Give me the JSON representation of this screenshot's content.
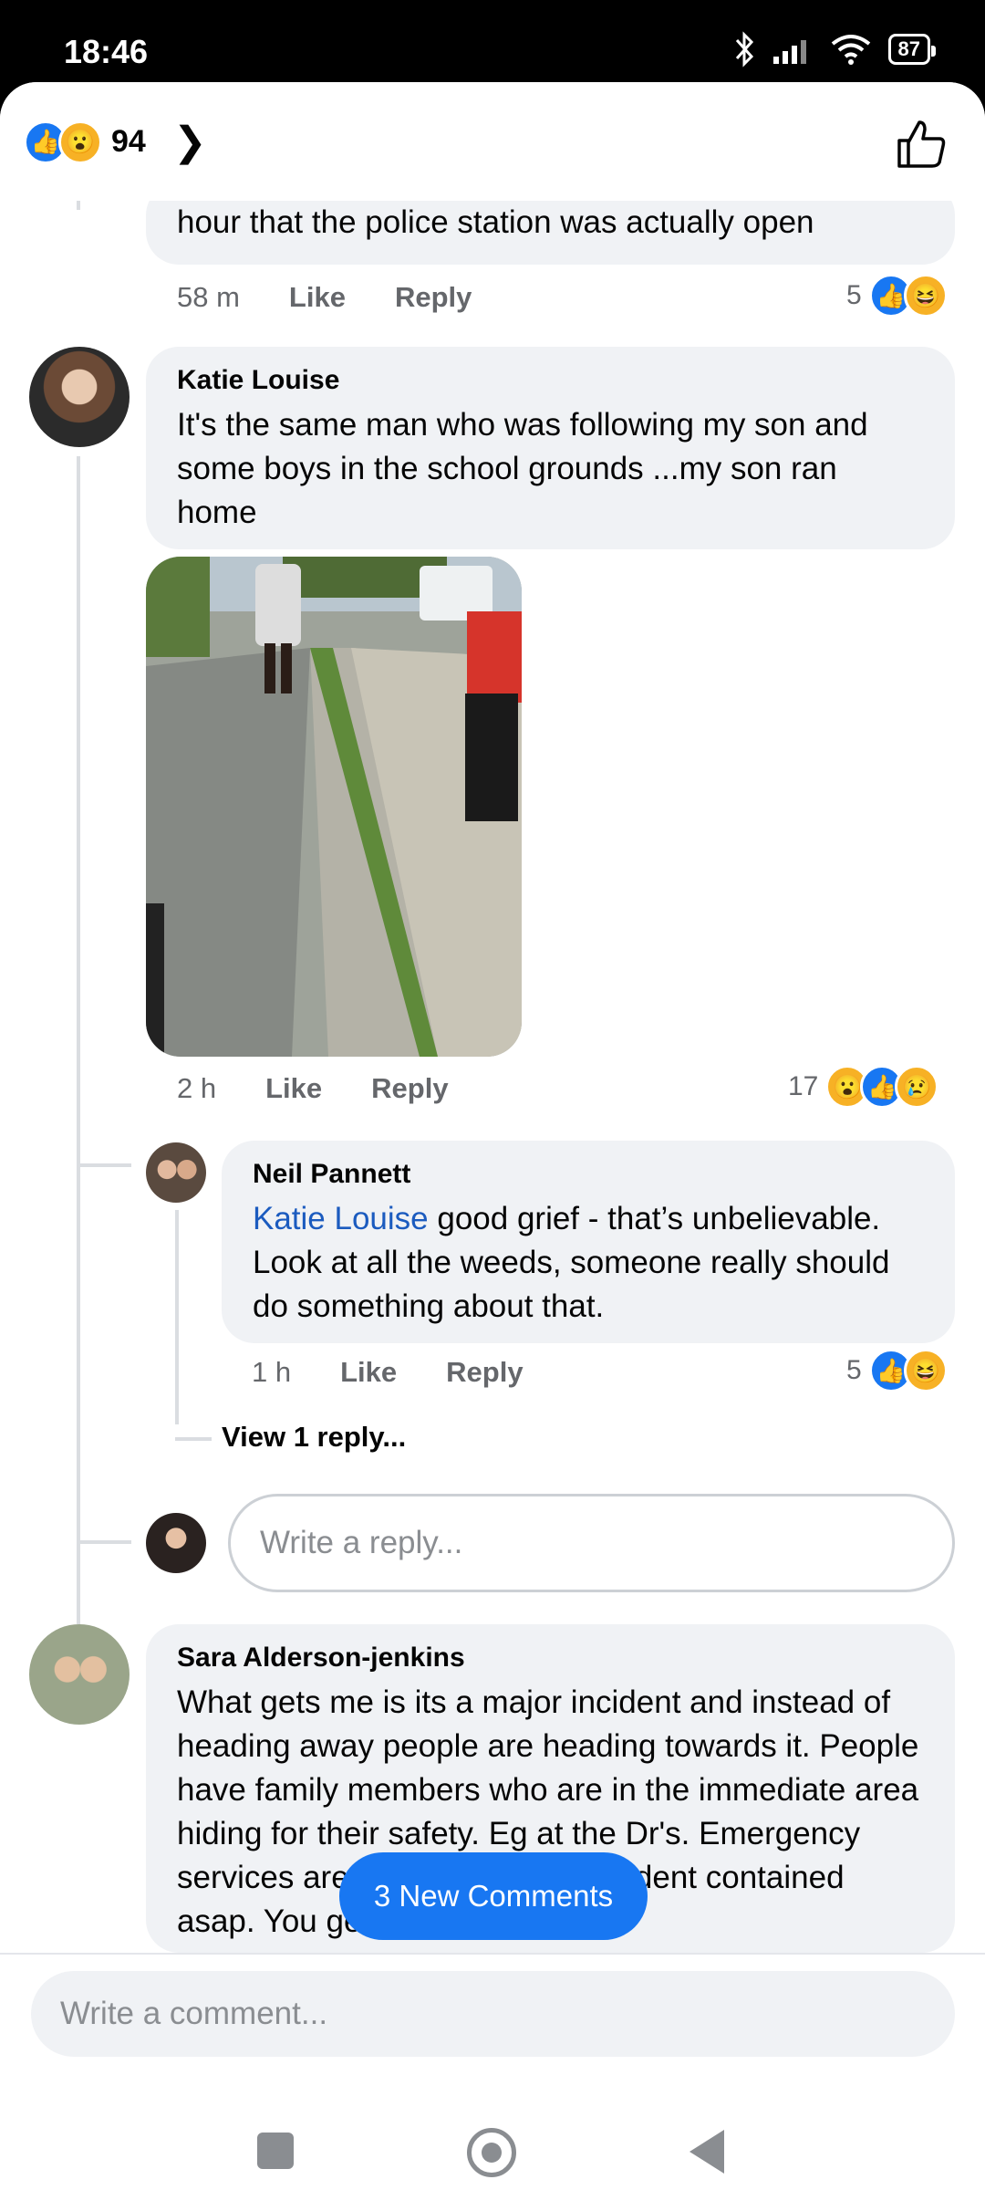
{
  "status": {
    "time": "18:46",
    "battery": "87"
  },
  "header": {
    "reaction_count": "94"
  },
  "comments": [
    {
      "text": "hour that the police station was actually open",
      "time": "58 m",
      "like": "Like",
      "reply": "Reply",
      "reactions": "5"
    },
    {
      "author": "Katie Louise",
      "text": "It's the same man who was following my son and some boys  in the school grounds ...my son ran home",
      "time": "2 h",
      "like": "Like",
      "reply": "Reply",
      "reactions": "17",
      "reply_item": {
        "author": "Neil Pannett",
        "mention": "Katie Louise",
        "text": " good grief - that’s unbelievable. Look at all the weeds, someone really should do something about that.",
        "time": "1 h",
        "like": "Like",
        "reply": "Reply",
        "reactions": "5"
      },
      "view_replies": "View 1 reply...",
      "reply_placeholder": "Write a reply..."
    },
    {
      "author": "Sara Alderson-jenkins",
      "text": "What gets me is its a major incident and instead of heading away people are heading towards it. People have family members who are in the immediate area hiding for their safety. Eg at the Dr's.  Emergency services are trying to get the incident contained asap. You get the"
    }
  ],
  "new_comments_label": "3 New Comments",
  "comment_placeholder": "Write a comment...",
  "colors": {
    "accent": "#1877f2",
    "bubble": "#f0f2f5",
    "mention": "#1b5bbf"
  }
}
